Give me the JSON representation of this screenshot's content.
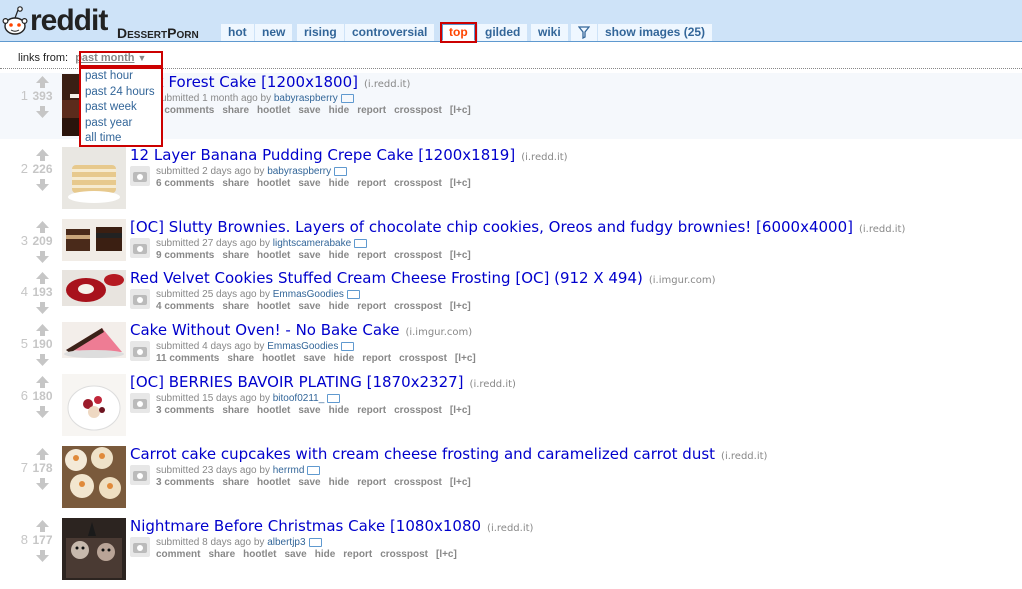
{
  "header": {
    "logo_text": "reddit",
    "subreddit": "DessertPorn",
    "tabs": [
      "hot",
      "new",
      "rising",
      "controversial",
      "top",
      "gilded",
      "wiki",
      "show images (25)"
    ]
  },
  "links_from": {
    "label": "links from:",
    "selected": "past month",
    "options": [
      "past hour",
      "past 24 hours",
      "past week",
      "past year",
      "all time"
    ]
  },
  "colors": {
    "header_bg": "#cee3f8",
    "link": "#0000cc",
    "accent": "#ff4500",
    "highlight": "#cc0000"
  },
  "posts": [
    {
      "rank": "1",
      "score": "393",
      "title": "k Forest Cake [1200x1800]",
      "domain": "(i.redd.it)",
      "submitted": "submitted 1 month ago by",
      "author": "babyraspberry",
      "comments": "5 comments",
      "buttons": [
        "share",
        "hootlet",
        "save",
        "hide",
        "report",
        "crosspost",
        "[l+c]"
      ]
    },
    {
      "rank": "2",
      "score": "226",
      "title": "12 Layer Banana Pudding Crepe Cake [1200x1819]",
      "domain": "(i.redd.it)",
      "submitted": "submitted 2 days ago by",
      "author": "babyraspberry",
      "comments": "6 comments",
      "buttons": [
        "share",
        "hootlet",
        "save",
        "hide",
        "report",
        "crosspost",
        "[l+c]"
      ]
    },
    {
      "rank": "3",
      "score": "209",
      "title": "[OC] Slutty Brownies. Layers of chocolate chip cookies, Oreos and fudgy brownies! [6000x4000]",
      "domain": "(i.redd.it)",
      "submitted": "submitted 27 days ago by",
      "author": "lightscamerabake",
      "comments": "9 comments",
      "buttons": [
        "share",
        "hootlet",
        "save",
        "hide",
        "report",
        "crosspost",
        "[l+c]"
      ]
    },
    {
      "rank": "4",
      "score": "193",
      "title": "Red Velvet Cookies Stuffed Cream Cheese Frosting [OC] (912 X 494)",
      "domain": "(i.imgur.com)",
      "submitted": "submitted 25 days ago by",
      "author": "EmmasGoodies",
      "comments": "4 comments",
      "buttons": [
        "share",
        "hootlet",
        "save",
        "hide",
        "report",
        "crosspost",
        "[l+c]"
      ]
    },
    {
      "rank": "5",
      "score": "190",
      "title": "Cake Without Oven! - No Bake Cake",
      "domain": "(i.imgur.com)",
      "submitted": "submitted 4 days ago by",
      "author": "EmmasGoodies",
      "comments": "11 comments",
      "buttons": [
        "share",
        "hootlet",
        "save",
        "hide",
        "report",
        "crosspost",
        "[l+c]"
      ]
    },
    {
      "rank": "6",
      "score": "180",
      "title": "[OC] BERRIES BAVOIR PLATING [1870x2327]",
      "domain": "(i.redd.it)",
      "submitted": "submitted 15 days ago by",
      "author": "bitoof0211_",
      "comments": "3 comments",
      "buttons": [
        "share",
        "hootlet",
        "save",
        "hide",
        "report",
        "crosspost",
        "[l+c]"
      ]
    },
    {
      "rank": "7",
      "score": "178",
      "title": "Carrot cake cupcakes with cream cheese frosting and caramelized carrot dust",
      "domain": "(i.redd.it)",
      "submitted": "submitted 23 days ago by",
      "author": "herrmd",
      "comments": "3 comments",
      "buttons": [
        "share",
        "hootlet",
        "save",
        "hide",
        "report",
        "crosspost",
        "[l+c]"
      ]
    },
    {
      "rank": "8",
      "score": "177",
      "title": "Nightmare Before Christmas Cake [1080x1080",
      "domain": "(i.redd.it)",
      "submitted": "submitted 8 days ago by",
      "author": "albertjp3",
      "comments": "comment",
      "buttons": [
        "share",
        "hootlet",
        "save",
        "hide",
        "report",
        "crosspost",
        "[l+c]"
      ]
    }
  ]
}
